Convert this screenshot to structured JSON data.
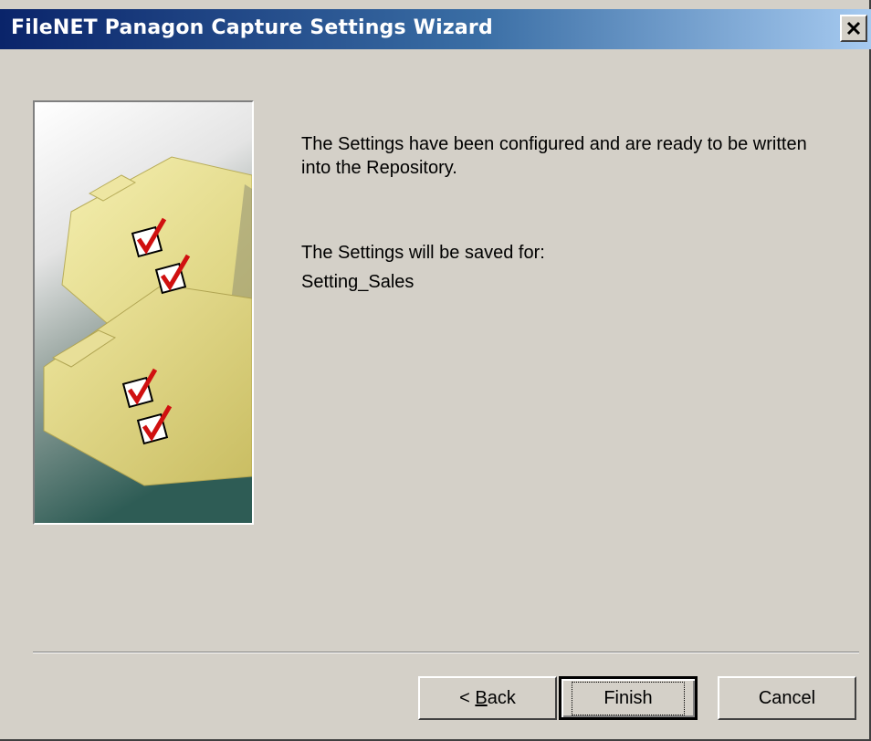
{
  "window": {
    "title": "FileNET Panagon Capture Settings Wizard"
  },
  "content": {
    "message_ready": "The Settings have been configured and are ready to be written into the Repository.",
    "saved_for_label": "The Settings will be saved for:",
    "setting_name": "Setting_Sales"
  },
  "buttons": {
    "back_label_prefix": "< ",
    "back_mnemonic": "B",
    "back_label_rest": "ack",
    "finish_label": "Finish",
    "cancel_label": "Cancel"
  },
  "icons": {
    "close": "close-icon",
    "illustration": "checked-folders-illustration"
  }
}
